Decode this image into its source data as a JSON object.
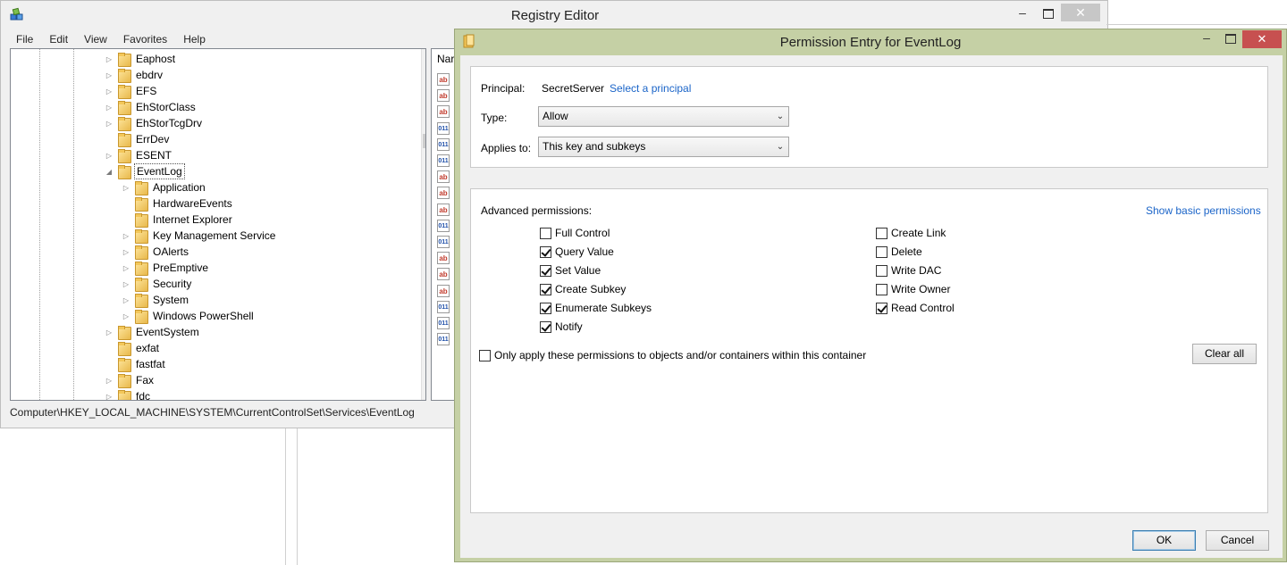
{
  "registry_editor": {
    "title": "Registry Editor",
    "menu": [
      "File",
      "Edit",
      "View",
      "Favorites",
      "Help"
    ],
    "window_controls": {
      "minimize": "–",
      "close": "✕"
    },
    "tree": [
      {
        "label": "Eaphost",
        "level": 1,
        "expander": "▷"
      },
      {
        "label": "ebdrv",
        "level": 1,
        "expander": "▷"
      },
      {
        "label": "EFS",
        "level": 1,
        "expander": "▷"
      },
      {
        "label": "EhStorClass",
        "level": 1,
        "expander": "▷"
      },
      {
        "label": "EhStorTcgDrv",
        "level": 1,
        "expander": "▷"
      },
      {
        "label": "ErrDev",
        "level": 1,
        "expander": ""
      },
      {
        "label": "ESENT",
        "level": 1,
        "expander": "▷"
      },
      {
        "label": "EventLog",
        "level": 1,
        "expander": "◢",
        "selected": true
      },
      {
        "label": "Application",
        "level": 2,
        "expander": "▷"
      },
      {
        "label": "HardwareEvents",
        "level": 2,
        "expander": ""
      },
      {
        "label": "Internet Explorer",
        "level": 2,
        "expander": ""
      },
      {
        "label": "Key Management Service",
        "level": 2,
        "expander": "▷"
      },
      {
        "label": "OAlerts",
        "level": 2,
        "expander": "▷"
      },
      {
        "label": "PreEmptive",
        "level": 2,
        "expander": "▷"
      },
      {
        "label": "Security",
        "level": 2,
        "expander": "▷"
      },
      {
        "label": "System",
        "level": 2,
        "expander": "▷"
      },
      {
        "label": "Windows PowerShell",
        "level": 2,
        "expander": "▷"
      },
      {
        "label": "EventSystem",
        "level": 1,
        "expander": "▷"
      },
      {
        "label": "exfat",
        "level": 1,
        "expander": ""
      },
      {
        "label": "fastfat",
        "level": 1,
        "expander": ""
      },
      {
        "label": "Fax",
        "level": 1,
        "expander": "▷"
      },
      {
        "label": "fdc",
        "level": 1,
        "expander": "▷"
      }
    ],
    "values_header": "Nar",
    "value_icons": [
      "ab",
      "ab",
      "ab",
      "bin",
      "bin",
      "bin",
      "ab",
      "ab",
      "ab",
      "bin",
      "bin",
      "ab",
      "ab",
      "ab",
      "bin",
      "bin",
      "bin"
    ],
    "status_path": "Computer\\HKEY_LOCAL_MACHINE\\SYSTEM\\CurrentControlSet\\Services\\EventLog"
  },
  "permission_dialog": {
    "title": "Permission Entry for EventLog",
    "principal_label": "Principal:",
    "principal_value": "SecretServer",
    "select_principal_link": "Select a principal",
    "type_label": "Type:",
    "type_value": "Allow",
    "applies_label": "Applies to:",
    "applies_value": "This key and subkeys",
    "advanced_label": "Advanced permissions:",
    "show_basic_link": "Show basic permissions",
    "permissions_left": [
      {
        "label": "Full Control",
        "checked": false
      },
      {
        "label": "Query Value",
        "checked": true
      },
      {
        "label": "Set Value",
        "checked": true
      },
      {
        "label": "Create Subkey",
        "checked": true
      },
      {
        "label": "Enumerate Subkeys",
        "checked": true
      },
      {
        "label": "Notify",
        "checked": true
      }
    ],
    "permissions_right": [
      {
        "label": "Create Link",
        "checked": false
      },
      {
        "label": "Delete",
        "checked": false
      },
      {
        "label": "Write DAC",
        "checked": false
      },
      {
        "label": "Write Owner",
        "checked": false
      },
      {
        "label": "Read Control",
        "checked": true
      }
    ],
    "only_apply_label": "Only apply these permissions to objects and/or containers within this container",
    "only_apply_checked": false,
    "clear_all": "Clear all",
    "ok": "OK",
    "cancel": "Cancel",
    "window_controls": {
      "minimize": "–",
      "close": "✕"
    }
  }
}
